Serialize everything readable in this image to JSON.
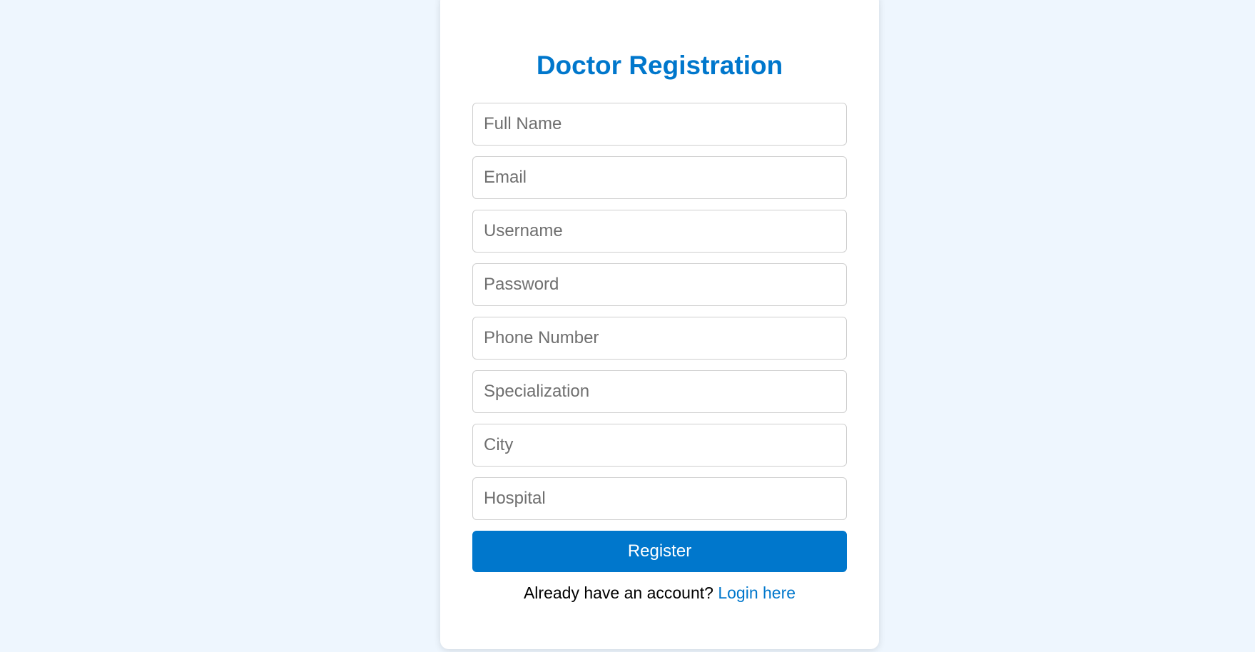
{
  "form": {
    "title": "Doctor Registration",
    "fields": {
      "full_name": {
        "placeholder": "Full Name",
        "value": ""
      },
      "email": {
        "placeholder": "Email",
        "value": ""
      },
      "username": {
        "placeholder": "Username",
        "value": ""
      },
      "password": {
        "placeholder": "Password",
        "value": ""
      },
      "phone": {
        "placeholder": "Phone Number",
        "value": ""
      },
      "specialization": {
        "placeholder": "Specialization",
        "value": ""
      },
      "city": {
        "placeholder": "City",
        "value": ""
      },
      "hospital": {
        "placeholder": "Hospital",
        "value": ""
      }
    },
    "register_label": "Register",
    "login_prompt": "Already have an account?",
    "login_link": "Login here"
  },
  "colors": {
    "accent": "#0077cc",
    "background": "#eef6fe",
    "card": "#ffffff"
  }
}
